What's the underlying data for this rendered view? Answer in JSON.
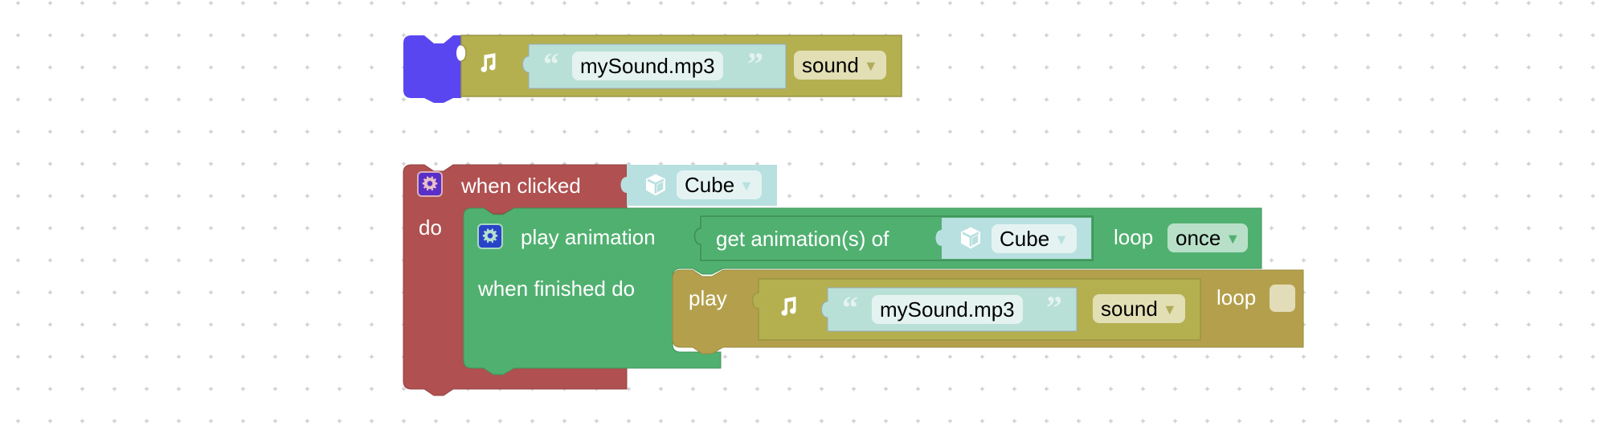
{
  "workspace": {
    "background": "#ffffff",
    "grid_color": "#cccccc"
  },
  "colors": {
    "sound_block": "#b4b050",
    "sound_block_dark": "#9a9642",
    "text_input": "#b9e0d6",
    "text_field": "#e4f3ef",
    "dropdown_sound": "#e2dfb5",
    "dropdown_sound_arrow": "#b0ac5a",
    "event_block": "#b05050",
    "animation_block": "#50b070",
    "object_input": "#b8e0e0",
    "play_block": "#b4a04c",
    "orphan_hat": "#5a46f0",
    "settings_badge_event": "#5a2ec8",
    "settings_badge_anim": "#2a44c8"
  },
  "orphan_block": {
    "sound_icon": "music-note-icon",
    "text_open_quote": "“",
    "text_value": "mySound.mp3",
    "text_close_quote": "”",
    "type_dropdown": "sound",
    "dropdown_arrow": "▼"
  },
  "event_block": {
    "settings_icon": "gear-icon",
    "label": "when clicked",
    "object_icon": "cube-icon",
    "object_dropdown": "Cube",
    "dropdown_arrow": "▼",
    "do_label": "do"
  },
  "animation_block": {
    "settings_icon": "gear-icon",
    "label": "play animation",
    "getter_label": "get animation(s) of",
    "object_icon": "cube-icon",
    "object_dropdown": "Cube",
    "dropdown_arrow": "▼",
    "loop_label": "loop",
    "loop_dropdown": "once",
    "finished_label": "when finished do"
  },
  "play_block": {
    "label": "play",
    "sound_icon": "music-note-icon",
    "text_open_quote": "“",
    "text_value": "mySound.mp3",
    "text_close_quote": "”",
    "type_dropdown": "sound",
    "dropdown_arrow": "▼",
    "loop_label": "loop",
    "loop_checked": false
  }
}
